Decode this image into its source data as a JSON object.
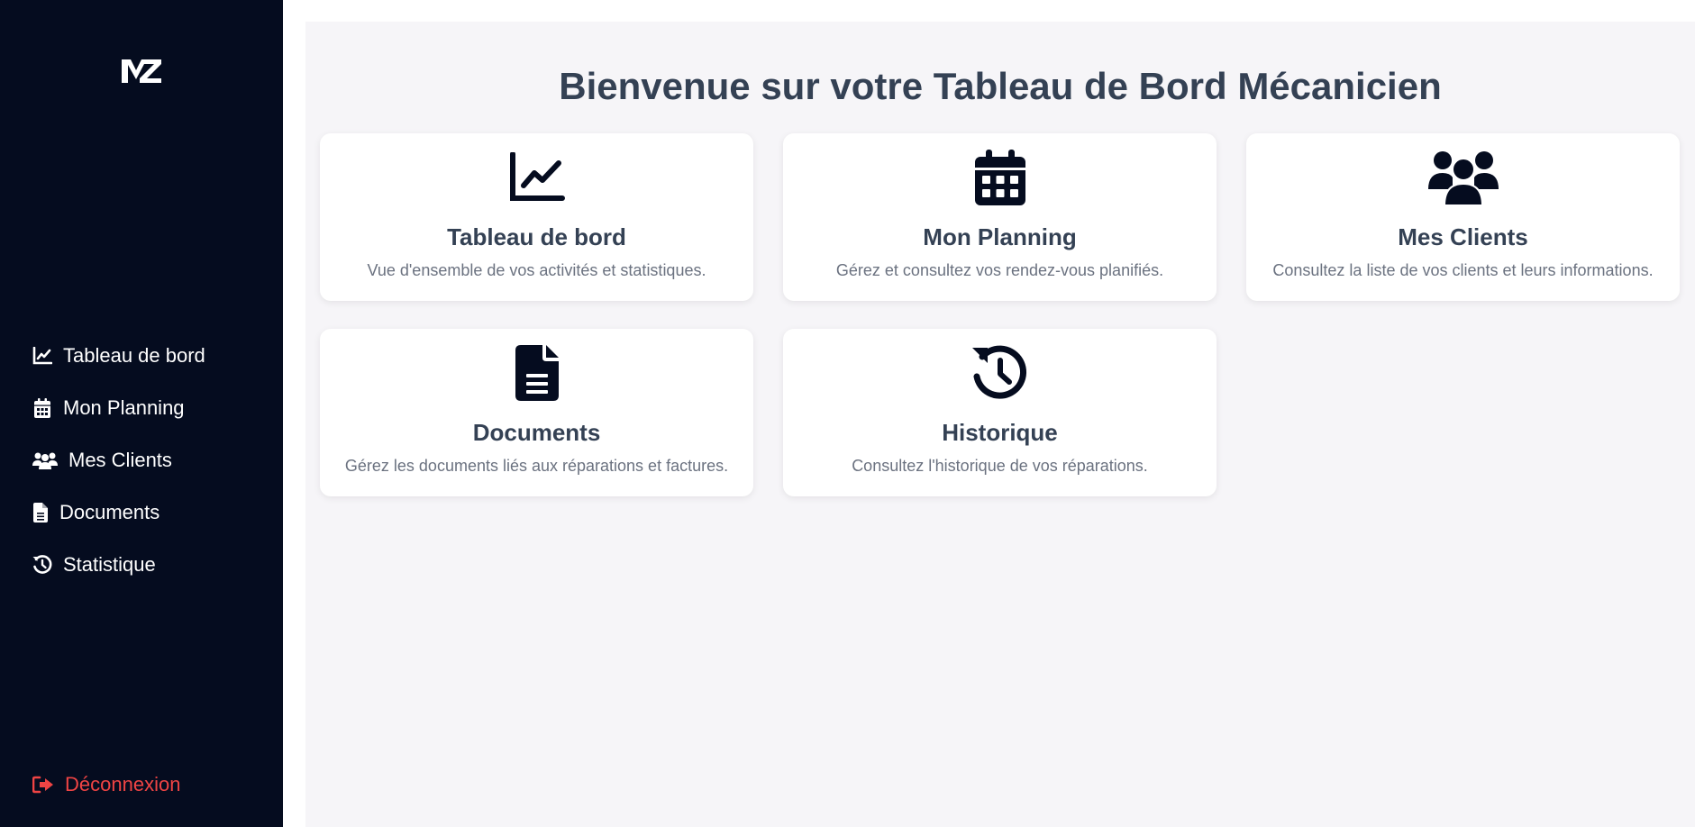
{
  "sidebar": {
    "logo_text": "MZ",
    "items": [
      {
        "label": "Tableau de bord",
        "icon": "chart-line-icon"
      },
      {
        "label": "Mon Planning",
        "icon": "calendar-icon"
      },
      {
        "label": "Mes Clients",
        "icon": "users-icon"
      },
      {
        "label": "Documents",
        "icon": "file-icon"
      },
      {
        "label": "Statistique",
        "icon": "history-icon"
      }
    ],
    "logout_label": "Déconnexion",
    "logout_color": "#ef4444",
    "background": "#050c1f"
  },
  "main": {
    "title": "Bienvenue sur votre Tableau de Bord Mécanicien",
    "cards": [
      {
        "title": "Tableau de bord",
        "description": "Vue d'ensemble de vos activités et statistiques.",
        "icon": "chart-line-icon"
      },
      {
        "title": "Mon Planning",
        "description": "Gérez et consultez vos rendez-vous planifiés.",
        "icon": "calendar-icon"
      },
      {
        "title": "Mes Clients",
        "description": "Consultez la liste de vos clients et leurs informations.",
        "icon": "users-icon"
      },
      {
        "title": "Documents",
        "description": "Gérez les documents liés aux réparations et factures.",
        "icon": "file-icon"
      },
      {
        "title": "Historique",
        "description": "Consultez l'historique de vos réparations.",
        "icon": "history-icon"
      }
    ]
  }
}
